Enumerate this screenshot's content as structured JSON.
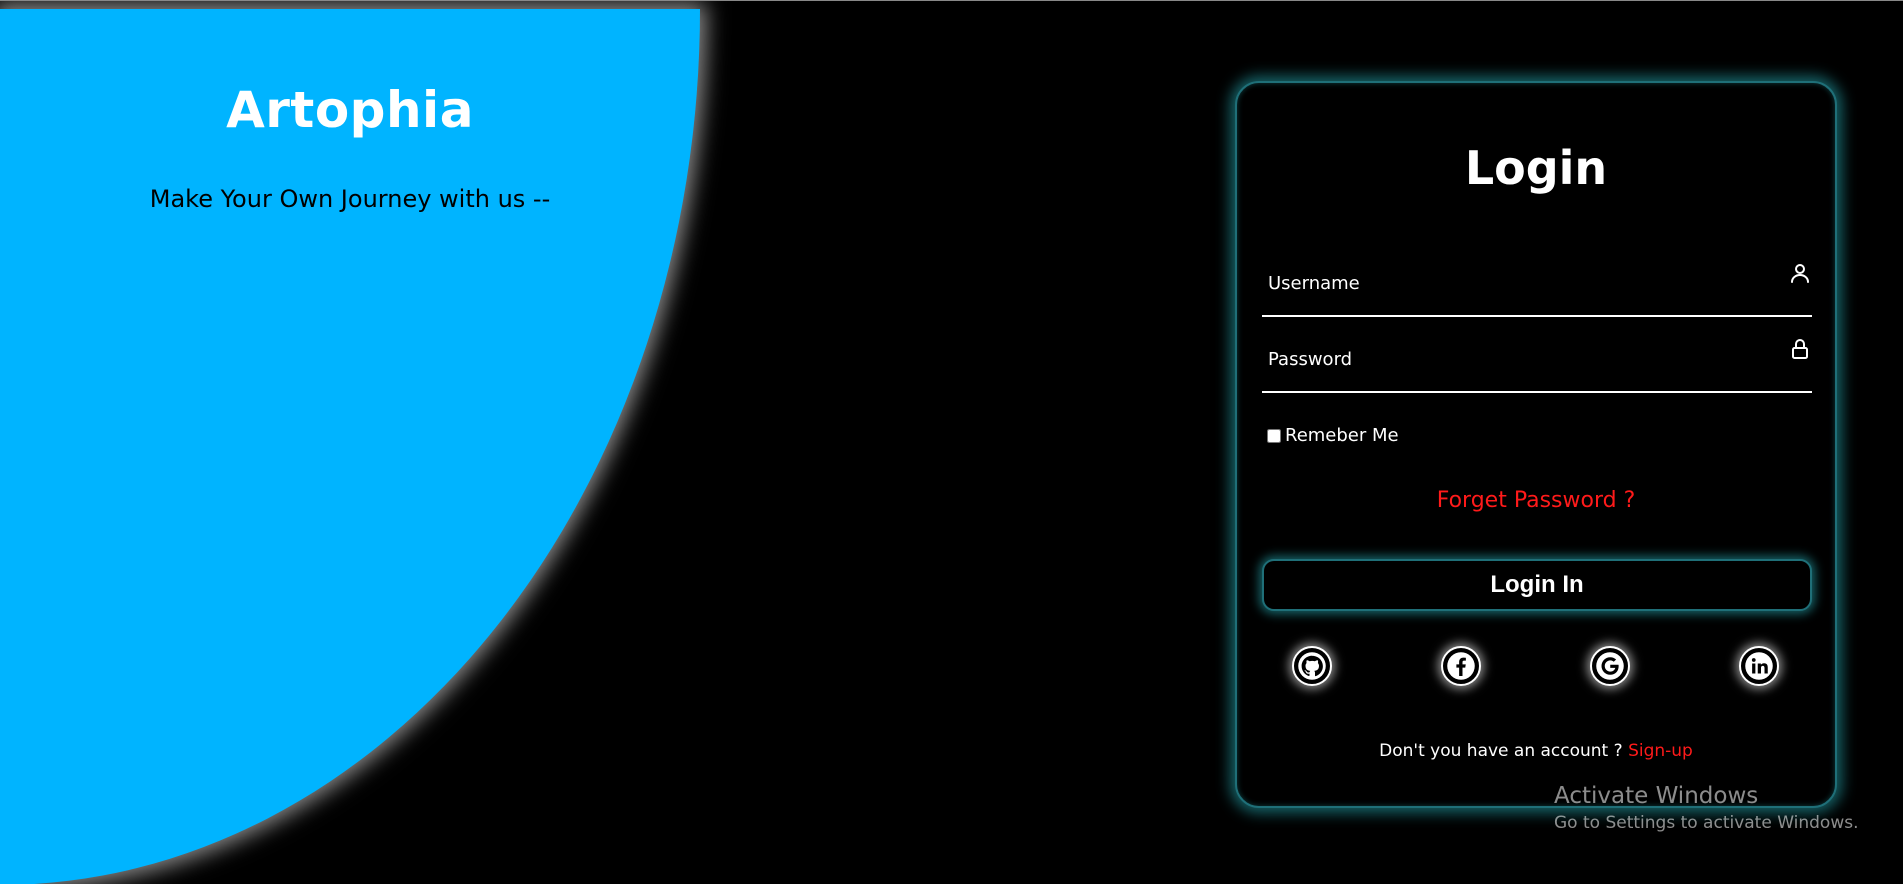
{
  "hero": {
    "title": "Artophia",
    "subtitle": "Make Your Own Journey with us --"
  },
  "login": {
    "title": "Login",
    "username_placeholder": "Username",
    "username_icon": "user-icon",
    "password_placeholder": "Password",
    "password_icon": "lock-icon",
    "remember_label": "Remeber Me",
    "remember_checked": false,
    "forgot_label": "Forget Password ?",
    "submit_label": "Login In",
    "socials": [
      "github-icon",
      "facebook-icon",
      "google-icon",
      "linkedin-icon"
    ],
    "signup_prompt": "Don't you have an account ?",
    "signup_link": "Sign-up"
  },
  "watermark": {
    "line1": "Activate Windows",
    "line2": "Go to Settings to activate Windows."
  },
  "colors": {
    "hero_bg": "#00b4ff",
    "card_glow": "#28b4be",
    "link_red": "#ff1a1a",
    "background": "#000000"
  }
}
